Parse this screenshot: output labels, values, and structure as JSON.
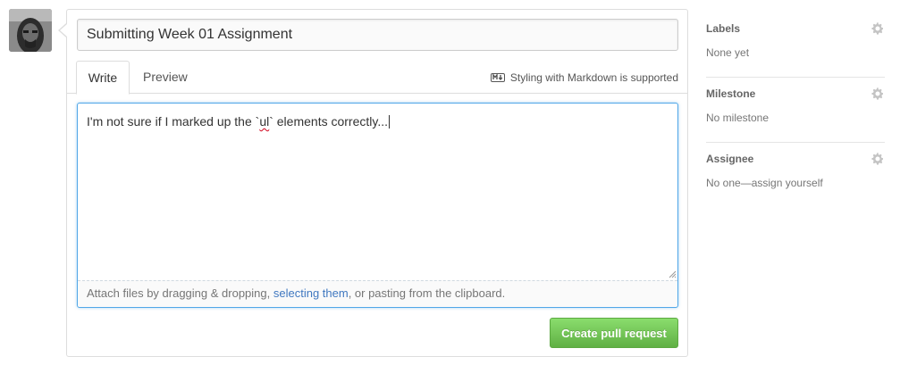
{
  "avatar": {
    "alt": "user avatar"
  },
  "form": {
    "title_value": "Submitting Week 01 Assignment",
    "tabs": [
      {
        "label": "Write",
        "active": true
      },
      {
        "label": "Preview",
        "active": false
      }
    ],
    "markdown_hint": "Styling with Markdown is supported",
    "comment": {
      "before": "I'm not sure if I marked up the `",
      "misspelled": "ul",
      "after": "` elements correctly..."
    },
    "attach": {
      "prefix": "Attach files by dragging & dropping, ",
      "link": "selecting them",
      "suffix": ", or pasting from the clipboard."
    },
    "submit_label": "Create pull request"
  },
  "sidebar": {
    "labels": {
      "heading": "Labels",
      "value": "None yet"
    },
    "milestone": {
      "heading": "Milestone",
      "value": "No milestone"
    },
    "assignee": {
      "heading": "Assignee",
      "value": "No one—assign yourself"
    }
  },
  "colors": {
    "focus_border": "#51a7e8",
    "link": "#4078c0",
    "button_green": "#60b044"
  },
  "icons": {
    "markdown": "markdown-icon",
    "gear": "gear-icon"
  }
}
